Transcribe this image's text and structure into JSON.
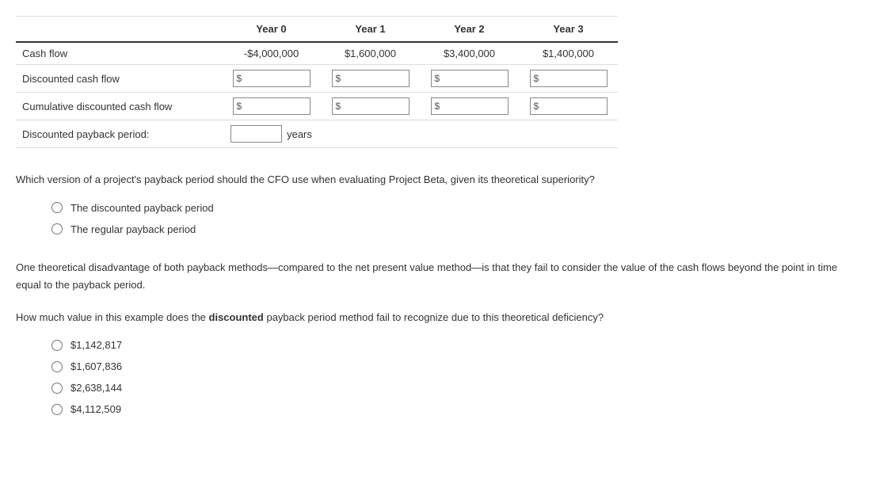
{
  "table": {
    "headers": [
      "",
      "Year 0",
      "Year 1",
      "Year 2",
      "Year 3"
    ],
    "rows": {
      "cash_flow": {
        "label": "Cash flow",
        "values": [
          "-$4,000,000",
          "$1,600,000",
          "$3,400,000",
          "$1,400,000"
        ]
      },
      "discounted_cash_flow": {
        "label": "Discounted cash flow",
        "prefix": "$"
      },
      "cumulative_discounted_cash_flow": {
        "label": "Cumulative discounted cash flow",
        "prefix": "$"
      },
      "discounted_payback_period": {
        "label": "Discounted payback period:",
        "suffix": "years"
      }
    }
  },
  "question1": {
    "text": "Which version of a project's payback period should the CFO use when evaluating Project Beta, given its theoretical superiority?",
    "options": [
      "The discounted payback period",
      "The regular payback period"
    ]
  },
  "paragraph": "One theoretical disadvantage of both payback methods—compared to the net present value method—is that they fail to consider the value of the cash flows beyond the point in time equal to the payback period.",
  "question2": {
    "text_before": "How much value in this example does the ",
    "text_bold": "discounted",
    "text_after": " payback period method fail to recognize due to this theoretical deficiency?",
    "options": [
      "$1,142,817",
      "$1,607,836",
      "$2,638,144",
      "$4,112,509"
    ]
  }
}
